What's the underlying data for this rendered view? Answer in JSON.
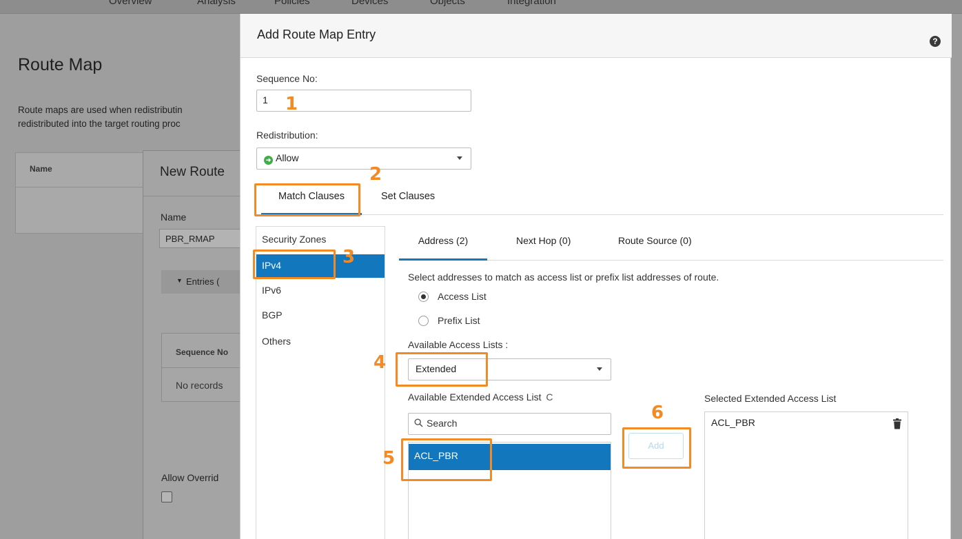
{
  "background": {
    "nav": [
      "Overview",
      "Analysis",
      "Policies",
      "Devices",
      "Objects",
      "Integration"
    ],
    "page_title": "Route Map",
    "description_line1": "Route maps are used when redistributin",
    "description_line2": "redistributed into the target routing proc",
    "table_header_name": "Name",
    "panel_title": "New Route",
    "name_label": "Name",
    "name_value": "PBR_RMAP",
    "entries_label": "Entries (",
    "seq_header": "Sequence No",
    "seq_empty": "No records",
    "allow_override_label": "Allow Overrid"
  },
  "modal": {
    "title": "Add Route Map Entry",
    "help_glyph": "?",
    "sequence_label": "Sequence No:",
    "sequence_value": "1",
    "redistribution_label": "Redistribution:",
    "redistribution_value": "Allow",
    "tabs": [
      "Match Clauses",
      "Set Clauses"
    ],
    "active_tab": "Match Clauses",
    "left_items": [
      "Security Zones",
      "IPv4",
      "IPv6",
      "BGP",
      "Others"
    ],
    "active_left_item": "IPv4",
    "sub_tabs": [
      "Address (2)",
      "Next Hop (0)",
      "Route Source (0)"
    ],
    "active_sub_tab": "Address (2)",
    "address_instructions": "Select addresses to match as access list or prefix list addresses of route.",
    "radio_access_list": "Access List",
    "radio_prefix_list": "Prefix List",
    "radio_selected": "Access List",
    "available_access_lists_label": "Available Access Lists :",
    "access_list_type": "Extended",
    "available_extended_label": "Available Extended Access List",
    "refresh_glyph": "C",
    "search_placeholder": "Search",
    "available_items": [
      "ACL_PBR"
    ],
    "add_button": "Add",
    "selected_label": "Selected Extended Access List",
    "selected_items": [
      "ACL_PBR"
    ]
  },
  "annotations": [
    "1",
    "2",
    "3",
    "4",
    "5",
    "6"
  ],
  "colors": {
    "accent": "#1277bd",
    "annotation": "#f28a26",
    "allow_green": "#3fae49"
  }
}
